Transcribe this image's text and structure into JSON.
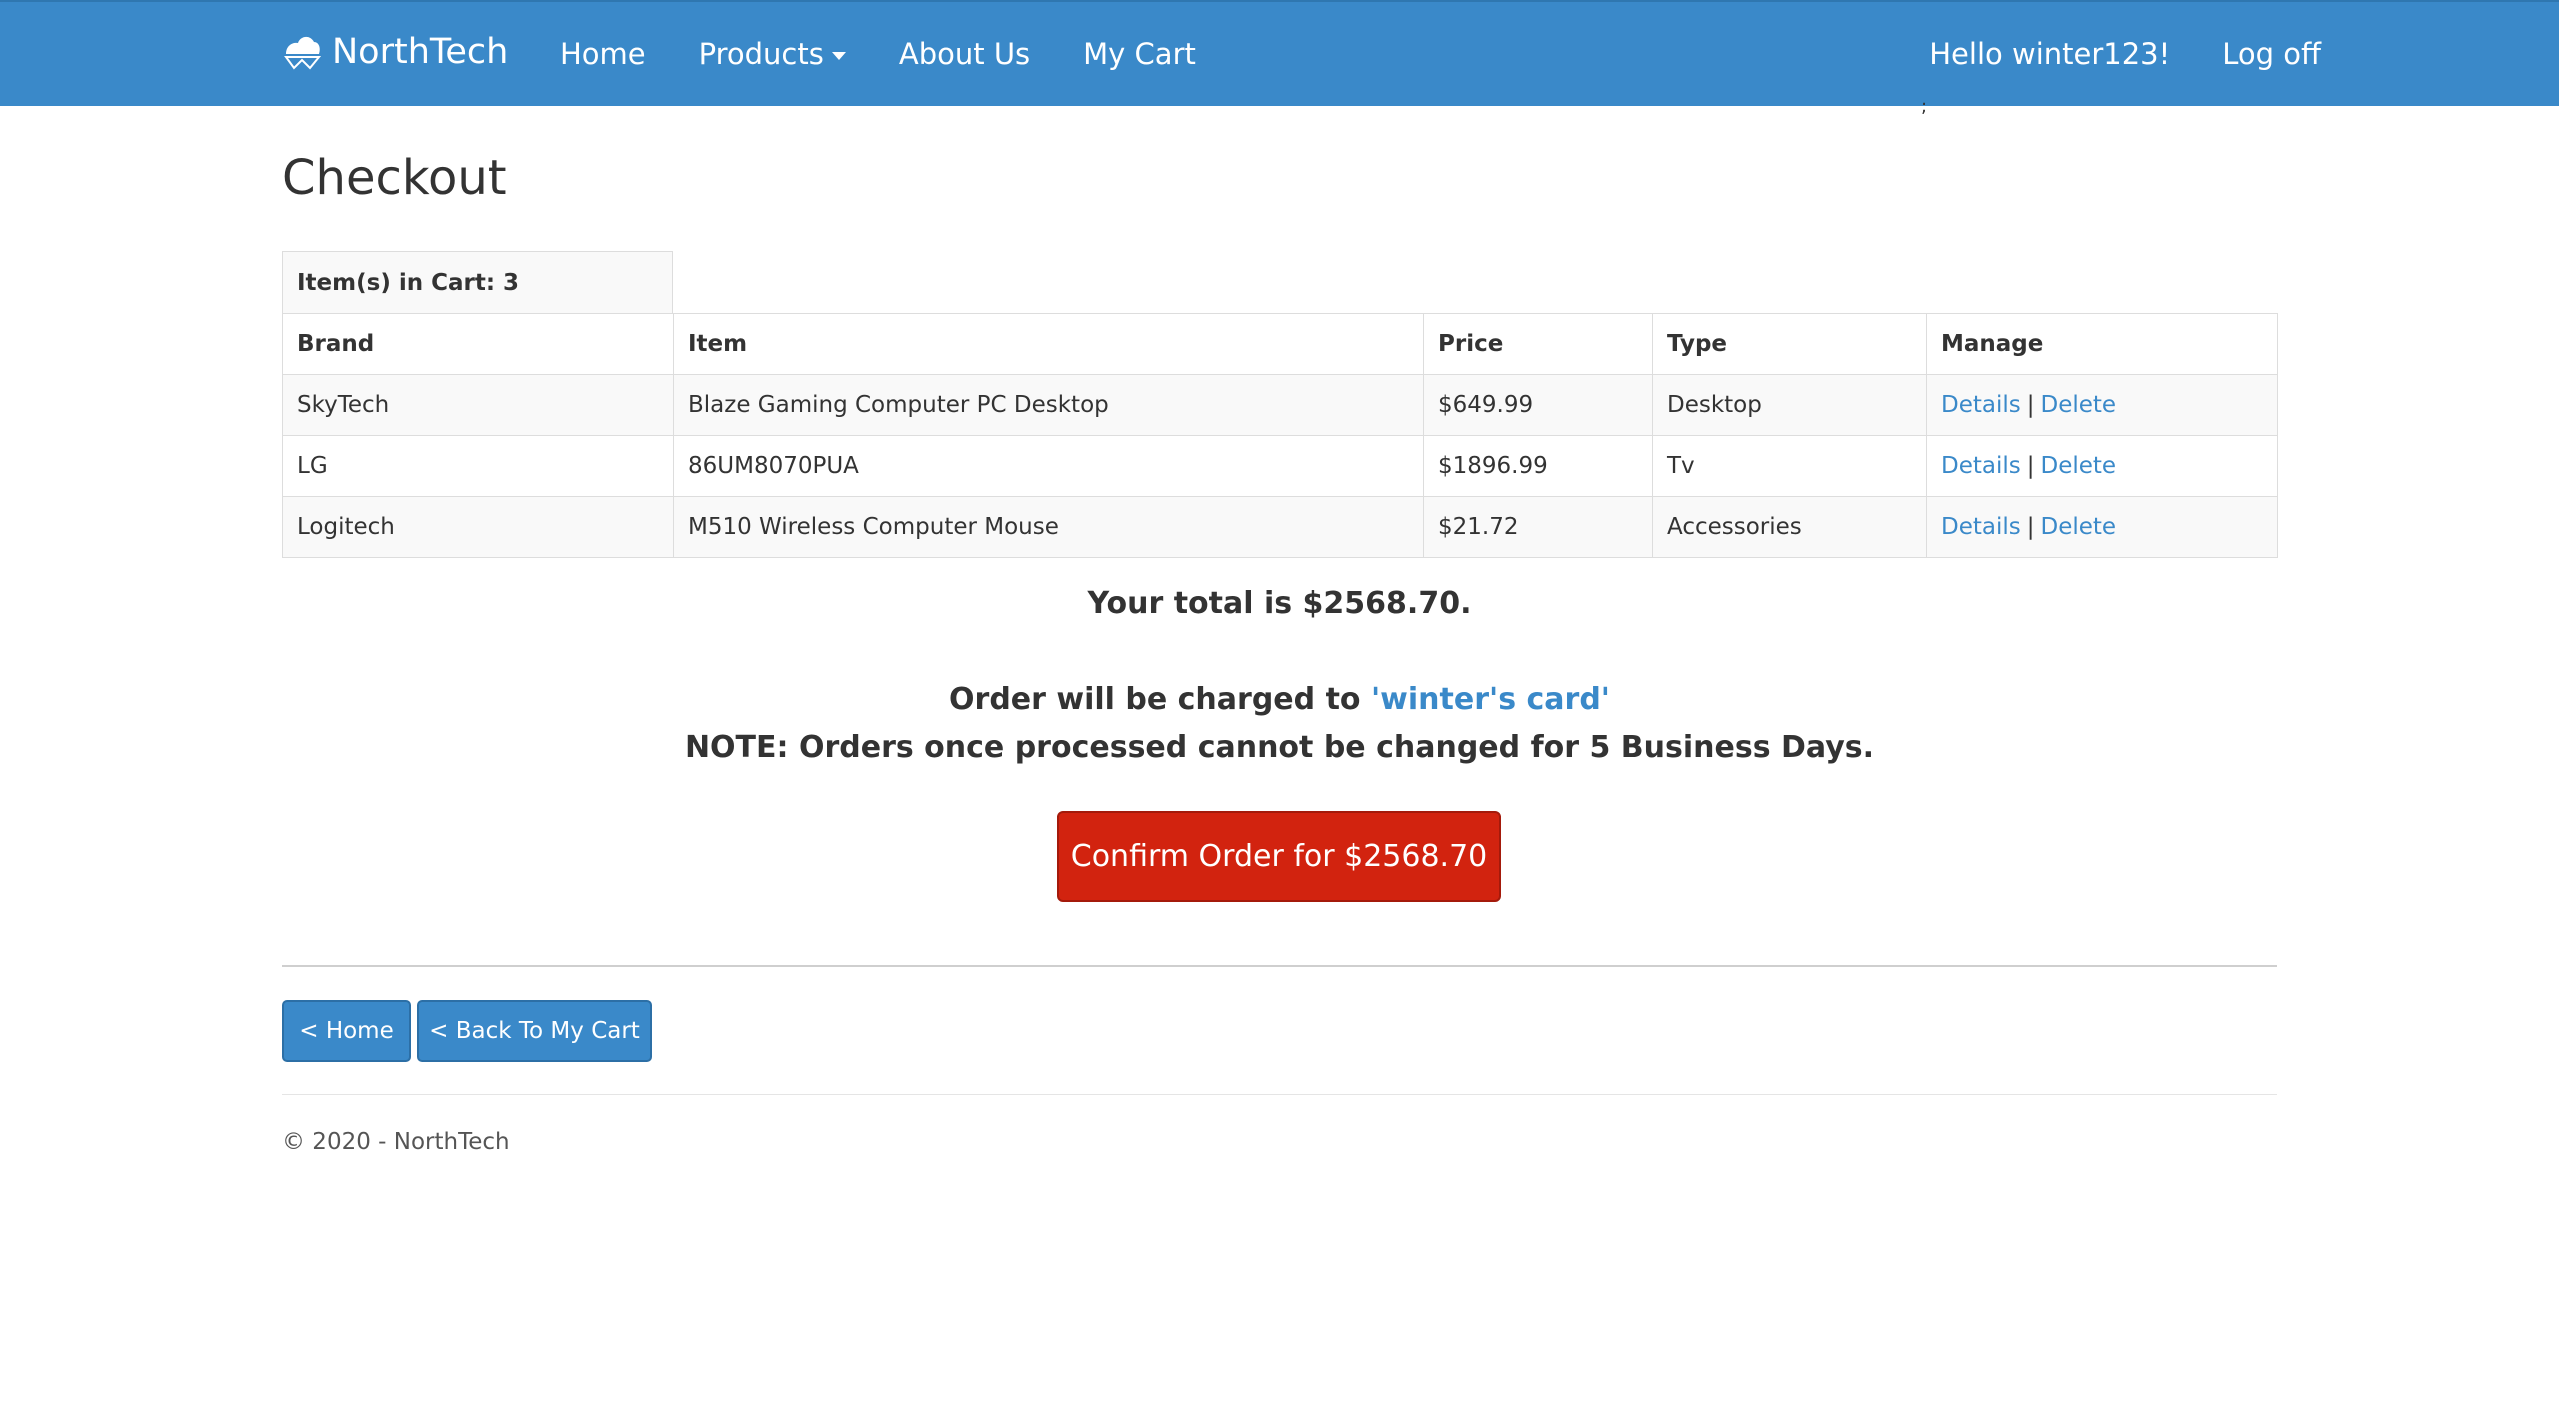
{
  "navbar": {
    "brand": "NorthTech",
    "brand_icon": "cloud-mountain-icon",
    "links": [
      "Home",
      "Products",
      "About Us",
      "My Cart"
    ],
    "greeting": "Hello winter123!",
    "logoff": "Log off",
    "stray_mark": ";",
    "bg_color": "#3a89c9"
  },
  "page": {
    "title": "Checkout",
    "cart_count_label": "Item(s) in Cart: 3"
  },
  "table": {
    "headers": [
      "Brand",
      "Item",
      "Price",
      "Type",
      "Manage"
    ],
    "rows": [
      {
        "brand": "SkyTech",
        "item": "Blaze Gaming Computer PC Desktop",
        "price": "$649.99",
        "type": "Desktop",
        "details": "Details",
        "sep": "|",
        "delete": "Delete"
      },
      {
        "brand": "LG",
        "item": "86UM8070PUA",
        "price": "$1896.99",
        "type": "Tv",
        "details": "Details",
        "sep": "|",
        "delete": "Delete"
      },
      {
        "brand": "Logitech",
        "item": "M510 Wireless Computer Mouse",
        "price": "$21.72",
        "type": "Accessories",
        "details": "Details",
        "sep": "|",
        "delete": "Delete"
      }
    ]
  },
  "summary": {
    "total_text": "Your total is $2568.70.",
    "charge_prefix": "Order will be charged to",
    "card_name": "'winter's card'",
    "note": "NOTE: Orders once processed cannot be changed for 5 Business Days."
  },
  "buttons": {
    "confirm": "Confirm Order for $2568.70",
    "confirm_color": "#d2230f",
    "home": "< Home",
    "back_to_cart": "< Back To My Cart"
  },
  "footer": {
    "text": "© 2020 - NorthTech"
  }
}
